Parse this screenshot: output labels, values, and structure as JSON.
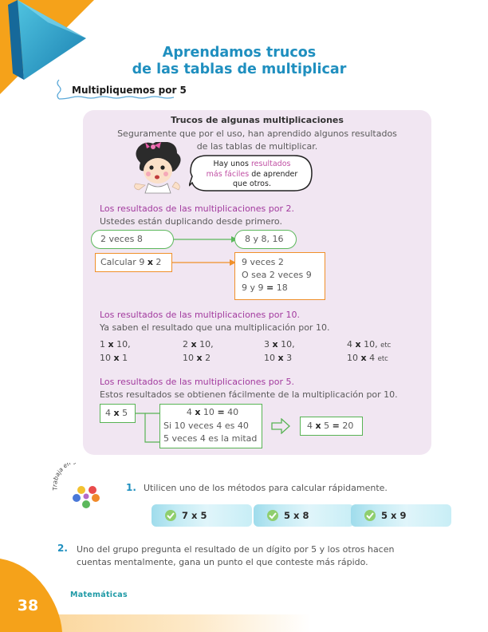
{
  "title": {
    "line1": "Aprendamos trucos",
    "line2": "de las tablas de multiplicar"
  },
  "subtitle": "Multipliquemos por 5",
  "panel": {
    "heading": "Trucos de algunas multiplicaciones",
    "intro_line1": "Seguramente que por el uso, han aprendido algunos resultados",
    "intro_line2": "de las tablas de multiplicar.",
    "bubble": {
      "pre": "Hay unos ",
      "highlight1": "resultados",
      "highlight2": "más fáciles",
      "post1": " de aprender",
      "post2": "que otros."
    },
    "section2": {
      "heading": "Los resultados de las multiplicaciones por 2.",
      "sub": "Ustedes están duplicando desde primero.",
      "oval_left": "2 veces 8",
      "oval_right": "8 y 8, 16",
      "calc_pre": "Calcular 9 ",
      "calc_op": "x",
      "calc_post": " 2",
      "result_line1": "9 veces 2",
      "result_line2": "O sea 2 veces 9",
      "result_line3_pre": "9 y 9 ",
      "result_line3_op": "=",
      "result_line3_post": " 18"
    },
    "section10": {
      "heading": "Los resultados de las multiplicaciones por 10.",
      "sub": "Ya saben el resultado que una multiplicación por 10.",
      "row1": [
        {
          "a": "1 ",
          "op": "x",
          "b": " 10,",
          "etc": ""
        },
        {
          "a": "2 ",
          "op": "x",
          "b": " 10,",
          "etc": ""
        },
        {
          "a": "3 ",
          "op": "x",
          "b": " 10,",
          "etc": ""
        },
        {
          "a": "4 ",
          "op": "x",
          "b": " 10,",
          "etc": "etc"
        }
      ],
      "row2": [
        {
          "a": "10 ",
          "op": "x",
          "b": " 1",
          "etc": ""
        },
        {
          "a": "10 ",
          "op": "x",
          "b": " 2",
          "etc": ""
        },
        {
          "a": "10 ",
          "op": "x",
          "b": " 3",
          "etc": ""
        },
        {
          "a": "10 ",
          "op": "x",
          "b": " 4",
          "etc": "etc"
        }
      ]
    },
    "section5": {
      "heading": "Los resultados de las multiplicaciones por 5.",
      "sub": "Estos resultados se obtienen fácilmente de la multiplicación por 10.",
      "box1_pre": "4 ",
      "box1_op": "x",
      "box1_post": " 5",
      "mid_line1_pre": "4 ",
      "mid_line1_op": "x",
      "mid_line1_mid": " 10 ",
      "mid_line1_eq": "=",
      "mid_line1_post": " 40",
      "mid_line2": "Si 10 veces 4 es 40",
      "mid_line3": "5 veces 4 es la mitad",
      "box3_pre": "4 ",
      "box3_op": "x",
      "box3_mid": " 5 ",
      "box3_eq": "=",
      "box3_post": " 20"
    }
  },
  "group_logo_text": "Trabaja en grupo",
  "q1": {
    "number": "1.",
    "text": "Utilicen uno de los métodos para calcular rápidamente.",
    "exercises": [
      {
        "a": "7 ",
        "op": "x",
        "b": " 5"
      },
      {
        "a": "5 ",
        "op": "x",
        "b": " 8"
      },
      {
        "a": "5 ",
        "op": "x",
        "b": " 9"
      }
    ]
  },
  "q2": {
    "number": "2.",
    "line1": "Uno del grupo pregunta el resultado de un dígito por 5 y los otros hacen",
    "line2": "cuentas mentalmente, gana un punto el que conteste más rápido."
  },
  "footer": {
    "subject": "Matemáticas",
    "page_number": "38"
  },
  "colors": {
    "title_blue": "#1f8fbf",
    "corner_orange": "#f5a21a",
    "panel_purple": "#f1e6f2",
    "heading_magenta": "#a23a9e",
    "oval_green": "#5cb85c",
    "box_orange": "#f0902a",
    "pill_cyan": "#9fdcec"
  }
}
